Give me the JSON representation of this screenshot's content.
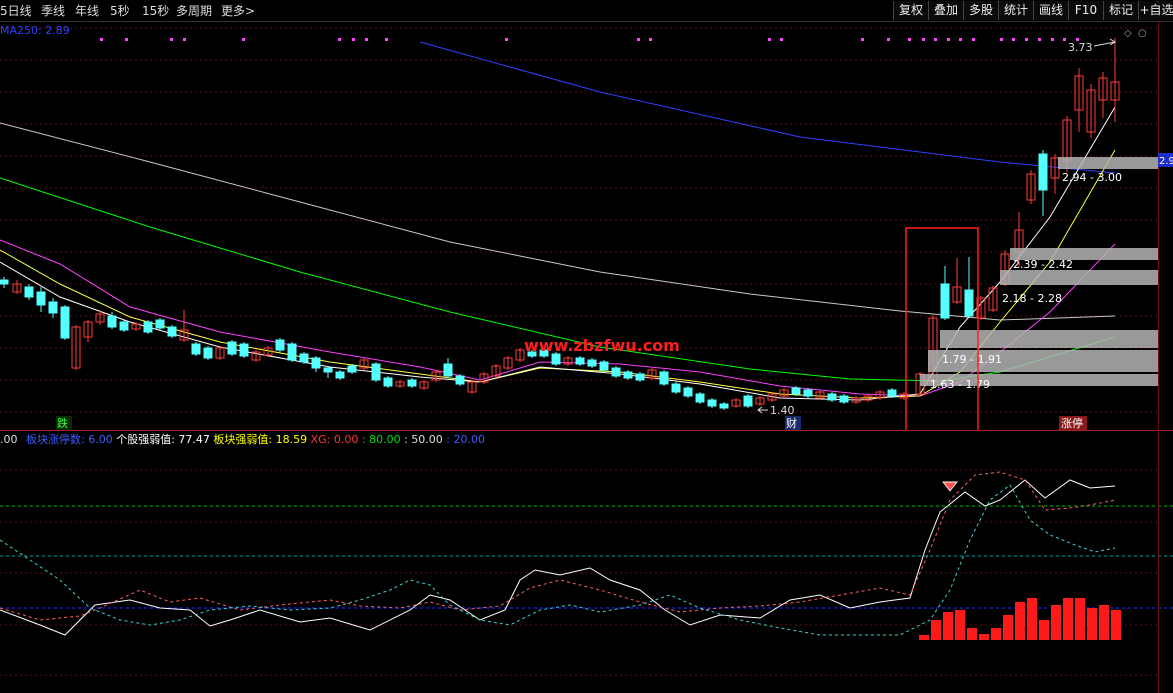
{
  "toolbar": {
    "periods": [
      "5日线",
      "季线",
      "年线",
      "5秒",
      "15秒",
      "多周期",
      "更多>"
    ],
    "buttons": [
      "复权",
      "叠加",
      "多股",
      "统计",
      "画线",
      "F10",
      "标记",
      "+自选"
    ]
  },
  "main": {
    "ma_label": "MA250: 2.89",
    "price_tag": "2.9",
    "high_label": "3.73",
    "low_label": "1.40",
    "marker_die": "跌",
    "marker_cai": "财",
    "marker_zhangting": "涨停",
    "watermark": "www.zbzfwu.com",
    "chips": [
      "2.94 - 3.00",
      "2.39 - 2.42",
      "2.18 - 2.28",
      "1.79 - 1.91",
      "1.63 - 1.79"
    ]
  },
  "indicator": {
    "prefix": ".00",
    "items": [
      {
        "label": "板块涨停数: 6.00",
        "color": "#3a5aff"
      },
      {
        "label": "个股强弱值: 77.47",
        "color": "#ffffff"
      },
      {
        "label": "板块强弱值: 18.59",
        "color": "#ffff00"
      },
      {
        "label": "XG: 0.00",
        "color": "#ff3333"
      },
      {
        "label": ": 80.00",
        "color": "#00e000"
      },
      {
        "label": ": 50.00",
        "color": "#dddddd"
      },
      {
        "label": ": 20.00",
        "color": "#3a5aff"
      }
    ]
  },
  "colors": {
    "up": "#ff3a3a",
    "down": "#54ffff",
    "ma5": "#ffffff",
    "ma10": "#ffff40",
    "ma20": "#ff40ff",
    "ma60": "#00ff00",
    "ma120": "#c8c8c8",
    "ma250": "#3040ff",
    "highlight_box": "#ff2020"
  }
}
